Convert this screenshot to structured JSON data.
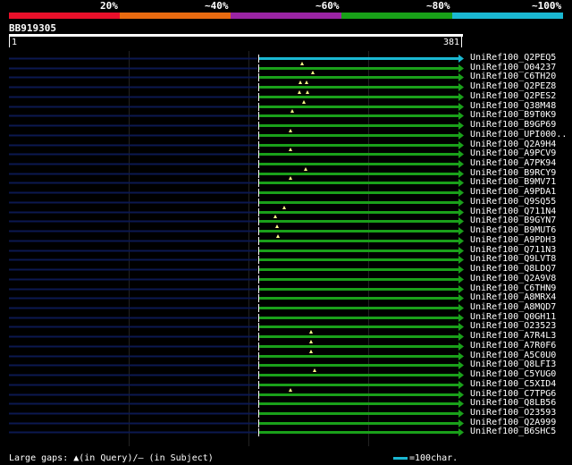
{
  "legend": {
    "segments": [
      {
        "color": "#e8102a",
        "label": "20%"
      },
      {
        "color": "#e86a10",
        "label": "~40%"
      },
      {
        "color": "#9a24a4",
        "label": "~60%"
      },
      {
        "color": "#18a018",
        "label": "~80%"
      },
      {
        "color": "#1ab8d2",
        "label": "~100%"
      }
    ]
  },
  "query": {
    "name": "BB919305",
    "start": "1",
    "end": "381"
  },
  "colors": {
    "hit_green": "#1aa01a",
    "hit_cyan": "#1ab8d2",
    "left_navy": "#0b1850",
    "gap_marker": "#ffff88"
  },
  "hits": [
    {
      "label": "UniRef100_Q2PEQ5",
      "color": "cyan",
      "markers": []
    },
    {
      "label": "UniRef100_O04237",
      "color": "green",
      "markers": [
        338
      ]
    },
    {
      "label": "UniRef100_C6TH20",
      "color": "green",
      "markers": [
        350
      ]
    },
    {
      "label": "UniRef100_Q2PEZ8",
      "color": "green",
      "markers": [
        336,
        343
      ]
    },
    {
      "label": "UniRef100_Q2PES2",
      "color": "green",
      "markers": [
        335,
        344
      ]
    },
    {
      "label": "UniRef100_Q38M48",
      "color": "green",
      "markers": [
        340
      ]
    },
    {
      "label": "UniRef100_B9T0K9",
      "color": "green",
      "markers": [
        327
      ]
    },
    {
      "label": "UniRef100_B9GP69",
      "color": "green",
      "markers": []
    },
    {
      "label": "UniRef100_UPI000..",
      "color": "green",
      "markers": [
        325
      ]
    },
    {
      "label": "UniRef100_Q2A9H4",
      "color": "green",
      "markers": []
    },
    {
      "label": "UniRef100_A9PCV9",
      "color": "green",
      "markers": [
        325
      ]
    },
    {
      "label": "UniRef100_A7PK94",
      "color": "green",
      "markers": []
    },
    {
      "label": "UniRef100_B9RCY9",
      "color": "green",
      "markers": [
        342
      ]
    },
    {
      "label": "UniRef100_B9MV71",
      "color": "green",
      "markers": [
        325
      ]
    },
    {
      "label": "UniRef100_A9PDA1",
      "color": "green",
      "markers": []
    },
    {
      "label": "UniRef100_Q9SQ55",
      "color": "green",
      "markers": []
    },
    {
      "label": "UniRef100_Q711N4",
      "color": "green",
      "markers": [
        318
      ]
    },
    {
      "label": "UniRef100_B9GYN7",
      "color": "green",
      "markers": [
        308
      ]
    },
    {
      "label": "UniRef100_B9MUT6",
      "color": "green",
      "markers": [
        310
      ]
    },
    {
      "label": "UniRef100_A9PDH3",
      "color": "green",
      "markers": [
        311
      ]
    },
    {
      "label": "UniRef100_Q711N3",
      "color": "green",
      "markers": []
    },
    {
      "label": "UniRef100_Q9LVT8",
      "color": "green",
      "markers": []
    },
    {
      "label": "UniRef100_Q8LDQ7",
      "color": "green",
      "markers": []
    },
    {
      "label": "UniRef100_Q2A9V8",
      "color": "green",
      "markers": []
    },
    {
      "label": "UniRef100_C6THN9",
      "color": "green",
      "markers": []
    },
    {
      "label": "UniRef100_A8MRX4",
      "color": "green",
      "markers": []
    },
    {
      "label": "UniRef100_A8MQD7",
      "color": "green",
      "markers": []
    },
    {
      "label": "UniRef100_Q0GH11",
      "color": "green",
      "markers": []
    },
    {
      "label": "UniRef100_O23523",
      "color": "green",
      "markers": []
    },
    {
      "label": "UniRef100_A7R4L3",
      "color": "green",
      "markers": [
        348
      ]
    },
    {
      "label": "UniRef100_A7R0F6",
      "color": "green",
      "markers": [
        348
      ]
    },
    {
      "label": "UniRef100_A5C0U0",
      "color": "green",
      "markers": [
        348
      ]
    },
    {
      "label": "UniRef100_Q8LFI3",
      "color": "green",
      "markers": []
    },
    {
      "label": "UniRef100_C5YUG0",
      "color": "green",
      "markers": [
        352
      ]
    },
    {
      "label": "UniRef100_C5XID4",
      "color": "green",
      "markers": []
    },
    {
      "label": "UniRef100_C7TPG6",
      "color": "green",
      "markers": [
        325
      ]
    },
    {
      "label": "UniRef100_Q8LB56",
      "color": "green",
      "markers": []
    },
    {
      "label": "UniRef100_O23593",
      "color": "green",
      "markers": []
    },
    {
      "label": "UniRef100_Q2A999",
      "color": "green",
      "markers": []
    },
    {
      "label": "UniRef100_B6SHC5",
      "color": "green",
      "markers": []
    }
  ],
  "footer": {
    "gaps_text": "Large gaps: ▲(in Query)/— (in Subject)",
    "scale_text": "=100char."
  }
}
